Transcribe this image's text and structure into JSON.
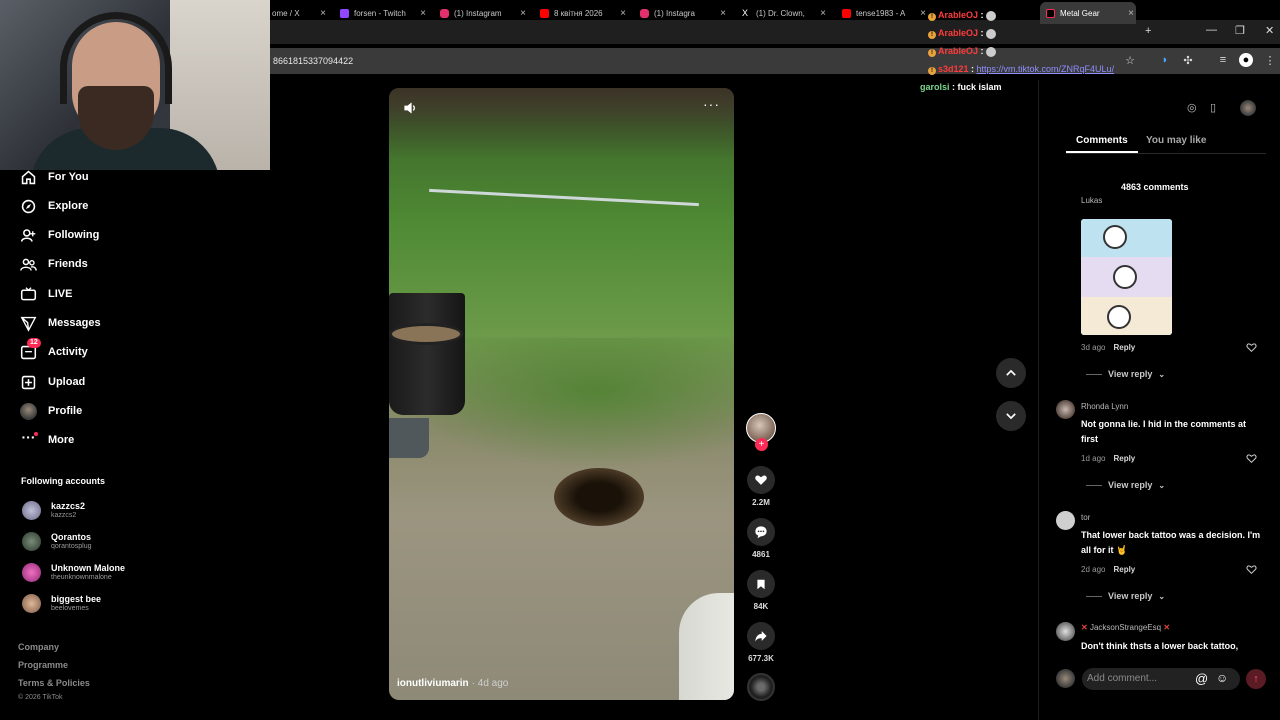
{
  "browser": {
    "tabs": [
      {
        "label": "ome / X",
        "icon": "x-logo-icon",
        "color": "#ffffff"
      },
      {
        "label": "forsen - Twitch",
        "icon": "twitch-icon",
        "color": "#9146ff"
      },
      {
        "label": "(1) Instagram",
        "icon": "instagram-icon",
        "color": "#e1306c"
      },
      {
        "label": "8 квітня 2026 ",
        "icon": "youtube-icon",
        "color": "#ff0000"
      },
      {
        "label": "(1) Instagra",
        "icon": "instagram-icon",
        "color": "#e1306c"
      },
      {
        "label": "(1) Dr. Clown, ",
        "icon": "x-logo-icon",
        "color": "#ffffff"
      },
      {
        "label": "tense1983 - A",
        "icon": "youtube-icon",
        "color": "#ff0000"
      },
      {
        "label": "Metal Gear",
        "icon": "tiktok-icon",
        "color": "#ffffff"
      }
    ],
    "new_tab": "+",
    "url": "8661815337094422"
  },
  "chat": [
    {
      "user": "ArableOJ",
      "user_color": "#ff3b3b",
      "message": "",
      "link": ""
    },
    {
      "user": "ArableOJ",
      "user_color": "#ff3b3b",
      "message": "",
      "link": ""
    },
    {
      "user": "ArableOJ",
      "user_color": "#ff3b3b",
      "message": "",
      "link": ""
    },
    {
      "user": "s3d121",
      "user_color": "#ff3b3b",
      "message": "",
      "link": "https://vm.tiktok.com/ZNRqF4ULu/"
    },
    {
      "user": "garolsi",
      "user_color": "#7bd88f",
      "message": "fuck islam",
      "link": ""
    }
  ],
  "sidebar": {
    "items": [
      {
        "label": "For You",
        "icon": "home-icon"
      },
      {
        "label": "Explore",
        "icon": "compass-icon"
      },
      {
        "label": "Following",
        "icon": "user-follow-icon"
      },
      {
        "label": "Friends",
        "icon": "friends-icon"
      },
      {
        "label": "LIVE",
        "icon": "live-icon"
      },
      {
        "label": "Messages",
        "icon": "send-icon"
      },
      {
        "label": "Activity",
        "icon": "inbox-icon",
        "badge": "12"
      },
      {
        "label": "Upload",
        "icon": "plus-square-icon"
      },
      {
        "label": "Profile",
        "icon": "avatar"
      },
      {
        "label": "More",
        "icon": "more-icon"
      }
    ],
    "following_title": "Following accounts",
    "accounts": [
      {
        "name": "kazzcs2",
        "handle": "kazzcs2",
        "color": "#8a8aa8"
      },
      {
        "name": "Qorantos",
        "handle": "qorantosplug",
        "color": "#3c4a3c"
      },
      {
        "name": "Unknown Malone",
        "handle": "theunknownmalone",
        "color": "#c03a9a"
      },
      {
        "name": "biggest bee",
        "handle": "beelovemes",
        "color": "#c89a7a"
      }
    ],
    "footer": [
      "Company",
      "Programme",
      "Terms & Policies"
    ],
    "copyright": "© 2026 TikTok"
  },
  "video": {
    "author": "ionutliviumarin",
    "age": "· 4d ago"
  },
  "actions": {
    "likes": "2.2M",
    "comments": "4861",
    "saves": "84K",
    "shares": "677.3K"
  },
  "panel": {
    "tab_comments": "Comments",
    "tab_you_may_like": "You may like",
    "count": "4863 comments",
    "comments": [
      {
        "user": "Lukas",
        "text": "",
        "time": "3d ago",
        "reply": "Reply",
        "view_reply": "View reply"
      },
      {
        "user": "Rhonda Lynn",
        "text": "Not gonna lie. I hid in the comments at first",
        "time": "1d ago",
        "reply": "Reply",
        "view_reply": "View reply"
      },
      {
        "user": "tor",
        "text": "That lower back tattoo was a decision. I'm all for it 🤘",
        "time": "2d ago",
        "reply": "Reply",
        "view_reply": "View reply"
      },
      {
        "user": "JacksonStrangeEsq",
        "text": "Don't think thsts a lower back tattoo,",
        "time": "",
        "reply": "",
        "view_reply": ""
      }
    ],
    "add_comment_placeholder": "Add comment..."
  }
}
